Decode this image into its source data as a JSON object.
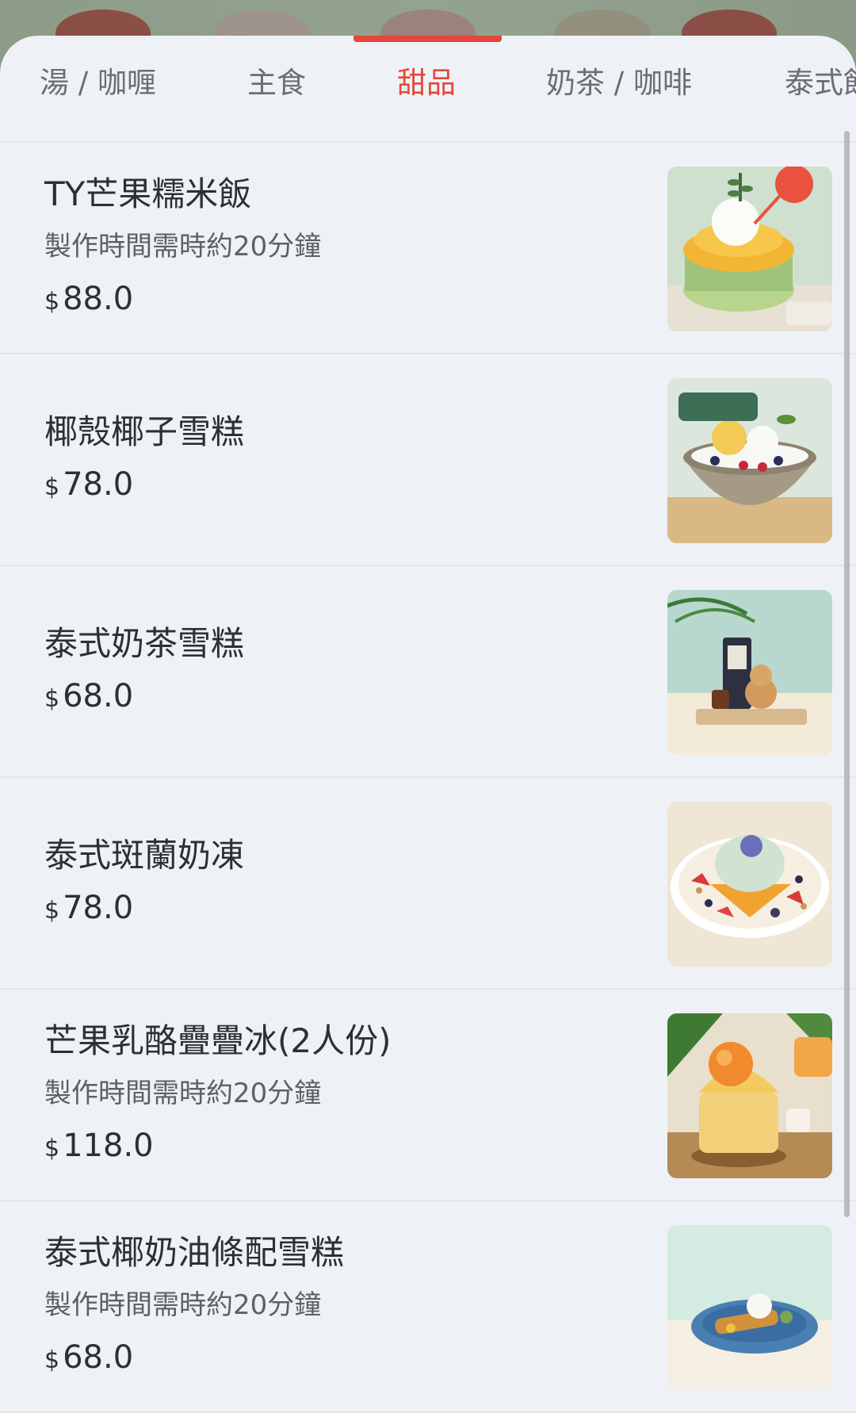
{
  "tabs": [
    {
      "label": "湯 / 咖喱",
      "active": false
    },
    {
      "label": "主食",
      "active": false
    },
    {
      "label": "甜品",
      "active": true
    },
    {
      "label": "奶茶 / 咖啡",
      "active": false
    },
    {
      "label": "泰式飲",
      "active": false
    }
  ],
  "menu": {
    "currency": "$",
    "items": [
      {
        "name": "TY芒果糯米飯",
        "note": "製作時間需時約20分鐘",
        "price": "88.0",
        "image": "mango-sticky-rice-photo"
      },
      {
        "name": "椰殼椰子雪糕",
        "note": "",
        "price": "78.0",
        "image": "coconut-shell-ice-cream-photo"
      },
      {
        "name": "泰式奶茶雪糕",
        "note": "",
        "price": "68.0",
        "image": "thai-milk-tea-ice-cream-photo"
      },
      {
        "name": "泰式斑蘭奶凍",
        "note": "",
        "price": "78.0",
        "image": "thai-pandan-pudding-photo"
      },
      {
        "name": "芒果乳酪疊疊冰(2人份)",
        "note": "製作時間需時約20分鐘",
        "price": "118.0",
        "image": "mango-yogurt-shaved-ice-photo"
      },
      {
        "name": "泰式椰奶油條配雪糕",
        "note": "製作時間需時約20分鐘",
        "price": "68.0",
        "image": "coconut-fried-dough-ice-cream-photo"
      }
    ]
  },
  "colors": {
    "accent": "#e5463a",
    "background": "#eef2f6",
    "text": "#2d2f31"
  }
}
